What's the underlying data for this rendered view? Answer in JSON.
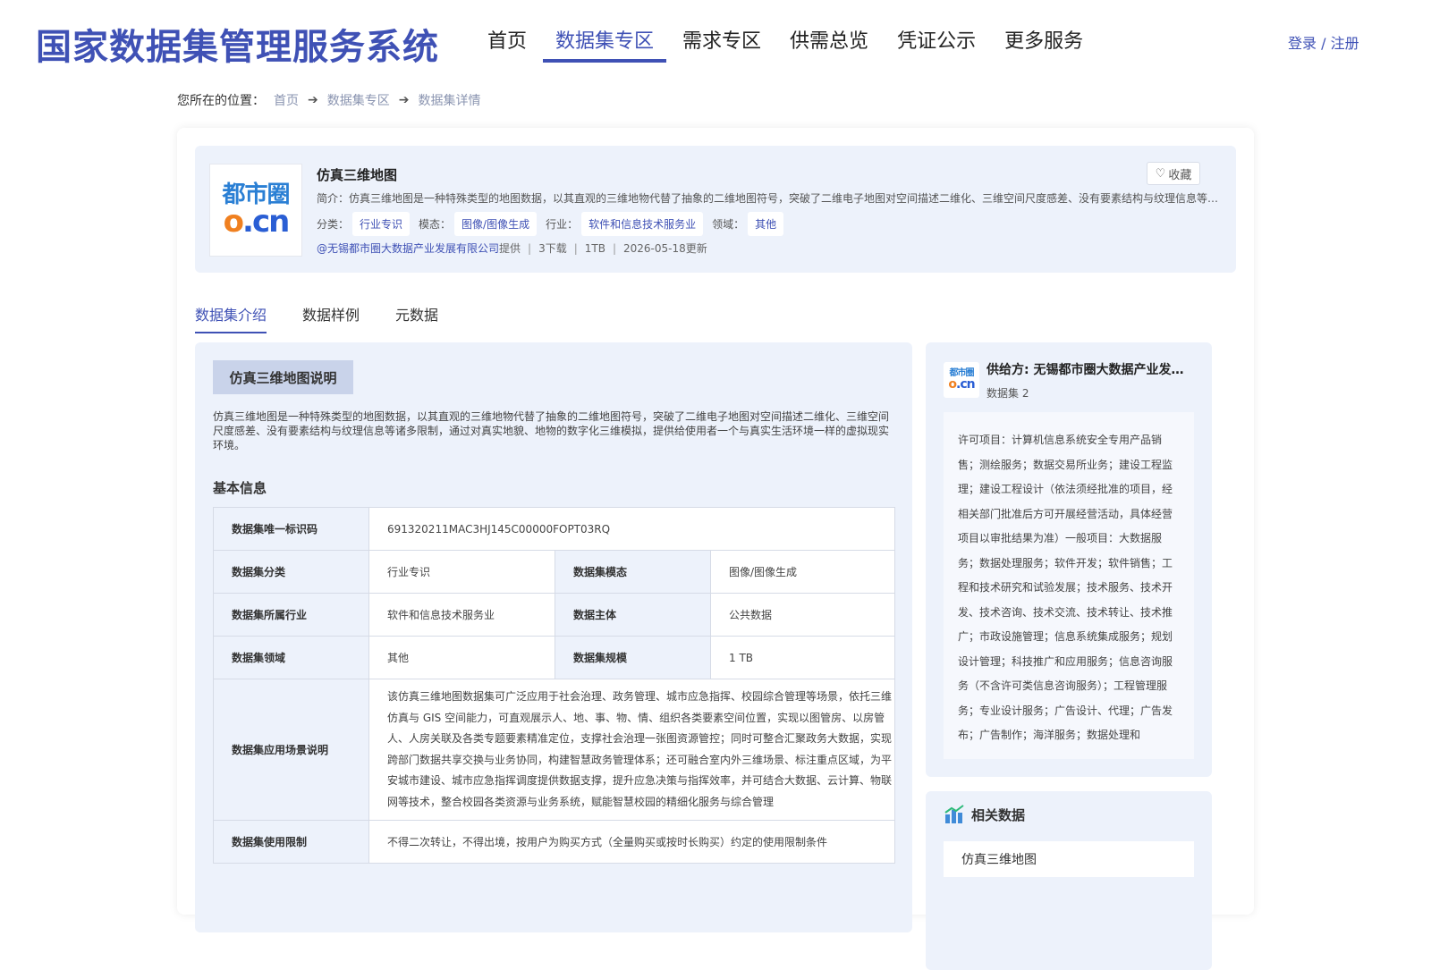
{
  "header": {
    "site_title": "国家数据集管理服务系统",
    "nav": [
      {
        "label": "首页"
      },
      {
        "label": "数据集专区"
      },
      {
        "label": "需求专区"
      },
      {
        "label": "供需总览"
      },
      {
        "label": "凭证公示"
      },
      {
        "label": "更多服务"
      }
    ],
    "login_label": "登录 / 注册"
  },
  "breadcrumb": {
    "prefix": "您所在的位置：",
    "items": [
      "首页",
      "数据集专区",
      "数据集详情"
    ]
  },
  "dataset": {
    "logo_top": "都市圈",
    "logo_bottom_o": "o",
    "logo_bottom_rest": ".cn",
    "title": "仿真三维地图",
    "intro": "简介：仿真三维地图是一种特殊类型的地图数据，以其直观的三维地物代替了抽象的二维地图符号，突破了二维电子地图对空间描述二维化、三维空间尺度感差、没有要素结构与纹理信息等诸多限制，通过对真实地貌、地物的数字化三维模拟，提供给使用者一个与真实生活环境一样的虚拟现实环境。",
    "favorite_label": "收藏",
    "tags": {
      "category_label": "分类：",
      "category": "行业专识",
      "modality_label": "模态：",
      "modality": "图像/图像生成",
      "industry_label": "行业：",
      "industry": "软件和信息技术服务业",
      "domain_label": "领域：",
      "domain": "其他"
    },
    "provider_link": "@无锡都市圈大数据产业发展有限公司",
    "provider_suffix": "提供",
    "downloads": "3下载",
    "size": "1TB",
    "updated": "2026-05-18更新"
  },
  "tabs": [
    {
      "label": "数据集介绍"
    },
    {
      "label": "数据样例"
    },
    {
      "label": "元数据"
    }
  ],
  "intro_section": {
    "label": "仿真三维地图说明",
    "description": "仿真三维地图是一种特殊类型的地图数据，以其直观的三维地物代替了抽象的二维地图符号，突破了二维电子地图对空间描述二维化、三维空间尺度感差、没有要素结构与纹理信息等诸多限制，通过对真实地貌、地物的数字化三维模拟，提供给使用者一个与真实生活环境一样的虚拟现实环境。",
    "basic_title": "基本信息"
  },
  "basic_info": {
    "id_label": "数据集唯一标识码",
    "id": "691320211MAC3HJ145C00000FOPT03RQ",
    "category_label": "数据集分类",
    "category": "行业专识",
    "modality_label": "数据集模态",
    "modality": "图像/图像生成",
    "industry_label": "数据集所属行业",
    "industry": "软件和信息技术服务业",
    "subject_label": "数据主体",
    "subject": "公共数据",
    "domain_label": "数据集领域",
    "domain": "其他",
    "scale_label": "数据集规模",
    "scale": "1 TB",
    "scenario_label": "数据集应用场景说明",
    "scenario": "该仿真三维地图数据集可广泛应用于社会治理、政务管理、城市应急指挥、校园综合管理等场景，依托三维仿真与 GIS 空间能力，可直观展示人、地、事、物、情、组织各类要素空间位置，实现以图管房、以房管人、人房关联及各类专题要素精准定位，支撑社会治理一张图资源管控；同时可整合汇聚政务大数据，实现跨部门数据共享交换与业务协同，构建智慧政务管理体系；还可融合室内外三维场景、标注重点区域，为平安城市建设、城市应急指挥调度提供数据支撑，提升应急决策与指挥效率，并可结合大数据、云计算、物联网等技术，整合校园各类资源与业务系统，赋能智慧校园的精细化服务与综合管理",
    "limit_label": "数据集使用限制",
    "limit": "不得二次转让，不得出境，按用户为购买方式（全量购买或按时长购买）约定的使用限制条件"
  },
  "supplier": {
    "name": "供给方: 无锡都市圈大数据产业发展有限公司",
    "count": "数据集 2",
    "description": "许可项目：计算机信息系统安全专用产品销售；测绘服务；数据交易所业务；建设工程监理；建设工程设计（依法须经批准的项目，经相关部门批准后方可开展经营活动，具体经营项目以审批结果为准）一般项目：大数据服务；数据处理服务；软件开发；软件销售；工程和技术研究和试验发展；技术服务、技术开发、技术咨询、技术交流、技术转让、技术推广；市政设施管理；信息系统集成服务；规划设计管理；科技推广和应用服务；信息咨询服务（不含许可类信息咨询服务）；工程管理服务；专业设计服务；广告设计、代理；广告发布；广告制作；海洋服务；数据处理和"
  },
  "related": {
    "title": "相关数据",
    "items": [
      "仿真三维地图"
    ]
  },
  "colors": {
    "accent": "#3f51b5",
    "panel_bg": "#edf2fb",
    "logo_blue": "#2a7fd4",
    "logo_orange": "#f08020"
  }
}
